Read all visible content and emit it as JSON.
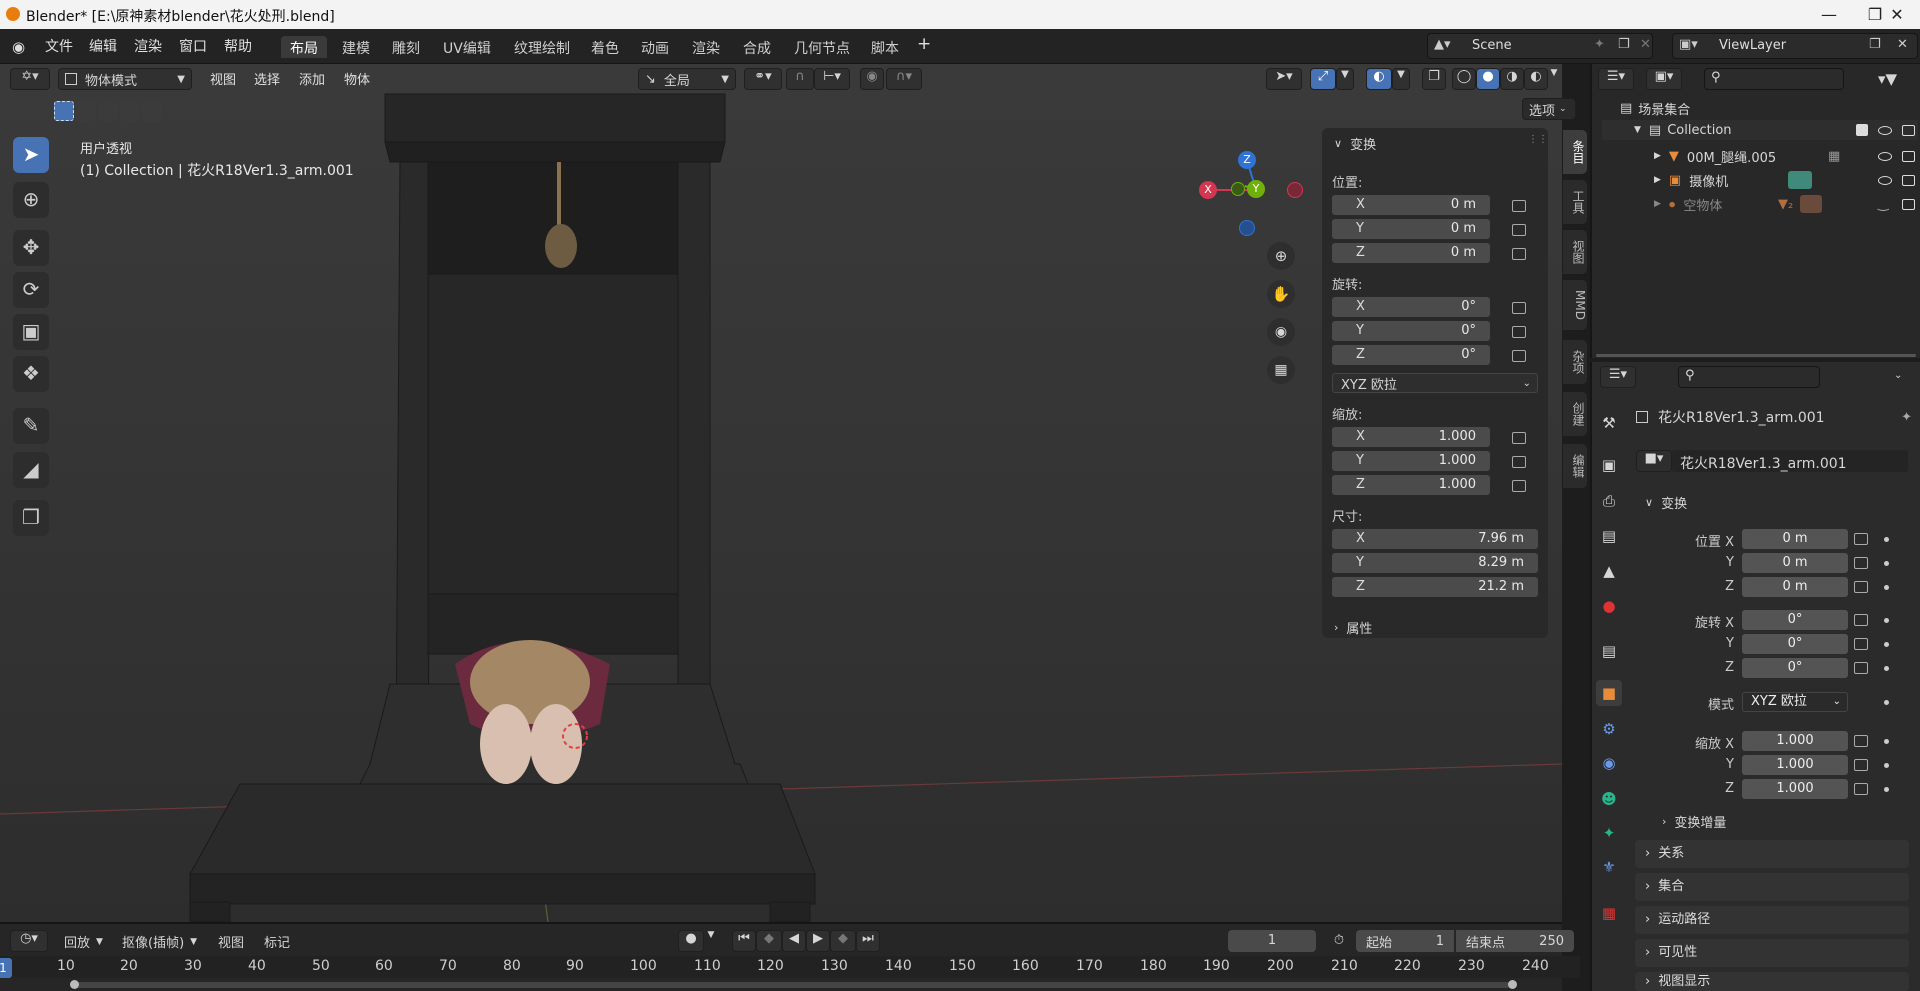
{
  "window": {
    "title": "Blender* [E:\\原神素材blender\\花火处刑.blend]"
  },
  "menu": [
    "文件",
    "编辑",
    "渲染",
    "窗口",
    "帮助"
  ],
  "workspaces": [
    "布局",
    "建模",
    "雕刻",
    "UV编辑",
    "纹理绘制",
    "着色",
    "动画",
    "渲染",
    "合成",
    "几何节点",
    "脚本"
  ],
  "scene": {
    "name": "Scene",
    "view_layer": "ViewLayer"
  },
  "viewport_header": {
    "mode": "物体模式",
    "menus": [
      "视图",
      "选择",
      "添加",
      "物体"
    ],
    "orientation": "全局",
    "options": "选项"
  },
  "viewport": {
    "view_name": "用户透视",
    "object_info": "(1) Collection | 花火R18Ver1.3_arm.001"
  },
  "gizmo": {
    "z": "Z",
    "y": "Y",
    "x": "X"
  },
  "npanel": {
    "header": "变换",
    "location_label": "位置:",
    "location": [
      {
        "axis": "X",
        "value": "0 m"
      },
      {
        "axis": "Y",
        "value": "0 m"
      },
      {
        "axis": "Z",
        "value": "0 m"
      }
    ],
    "rotation_label": "旋转:",
    "rotation": [
      {
        "axis": "X",
        "value": "0°"
      },
      {
        "axis": "Y",
        "value": "0°"
      },
      {
        "axis": "Z",
        "value": "0°"
      }
    ],
    "rotation_mode": "XYZ 欧拉",
    "scale_label": "缩放:",
    "scale": [
      {
        "axis": "X",
        "value": "1.000"
      },
      {
        "axis": "Y",
        "value": "1.000"
      },
      {
        "axis": "Z",
        "value": "1.000"
      }
    ],
    "dimensions_label": "尺寸:",
    "dimensions": [
      {
        "axis": "X",
        "value": "7.96 m"
      },
      {
        "axis": "Y",
        "value": "8.29 m"
      },
      {
        "axis": "Z",
        "value": "21.2 m"
      }
    ],
    "properties": "属性",
    "tabs": [
      "条目",
      "工具",
      "视图",
      "MMD",
      "杂项",
      "创建",
      "编辑"
    ]
  },
  "outliner": {
    "root": "场景集合",
    "collection": "Collection",
    "items": [
      "00M_腿绳.005",
      "摄像机",
      "空物体"
    ]
  },
  "properties": {
    "object_name": "花火R18Ver1.3_arm.001",
    "data_name": "花火R18Ver1.3_arm.001",
    "transform_header": "变换",
    "loc_labels": [
      "位置 X",
      "Y",
      "Z"
    ],
    "loc_values": [
      "0 m",
      "0 m",
      "0 m"
    ],
    "rot_labels": [
      "旋转 X",
      "Y",
      "Z"
    ],
    "rot_values": [
      "0°",
      "0°",
      "0°"
    ],
    "mode_label": "模式",
    "mode_value": "XYZ 欧拉",
    "scale_labels": [
      "缩放 X",
      "Y",
      "Z"
    ],
    "scale_values": [
      "1.000",
      "1.000",
      "1.000"
    ],
    "delta": "变换增量",
    "sections": [
      "关系",
      "集合",
      "运动路径",
      "可见性",
      "视图显示"
    ]
  },
  "timeline": {
    "menus": [
      "回放",
      "抠像(插帧)",
      "视图",
      "标记"
    ],
    "current_frame": "1",
    "start_label": "起始",
    "start": "1",
    "end_label": "结束点",
    "end": "250",
    "ticks": [
      "1",
      "10",
      "20",
      "30",
      "40",
      "50",
      "60",
      "70",
      "80",
      "90",
      "100",
      "110",
      "120",
      "130",
      "140",
      "150",
      "160",
      "170",
      "180",
      "190",
      "200",
      "210",
      "220",
      "230",
      "240"
    ]
  },
  "colors": {
    "accent": "#4772b3",
    "x_axis": "#d33650",
    "y_axis": "#6fb10a",
    "z_axis": "#2f73d6"
  }
}
